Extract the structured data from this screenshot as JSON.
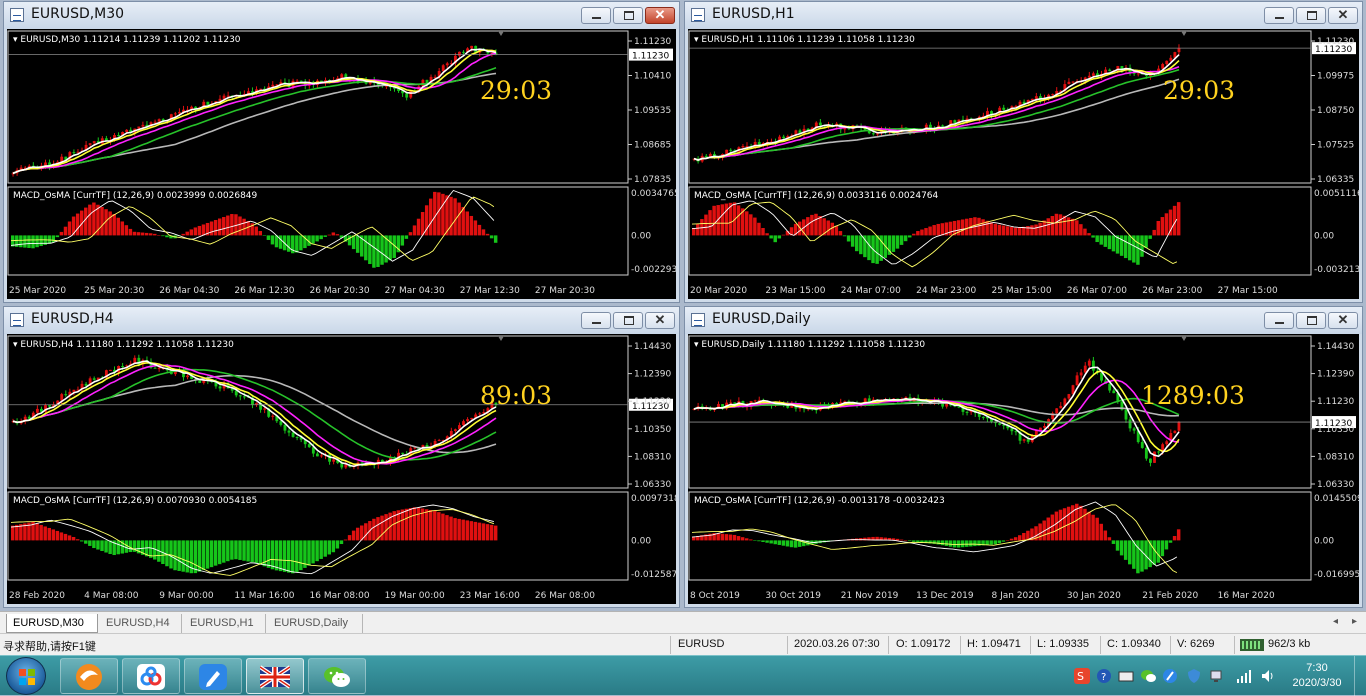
{
  "colors": {
    "bull": "#e01010",
    "bear": "#16c51a",
    "ema_fast": "#ffffff",
    "ema_mid": "#ffff33",
    "ema_slow": "#ff22ff",
    "sma_green": "#27c22a",
    "sma_gray": "#b8b8b8",
    "timer": "#ffd21f"
  },
  "windows": [
    {
      "id": "m30",
      "title": "EURUSD,M30",
      "close_active": true,
      "header": "EURUSD,M30  1.11214 1.11239 1.11202 1.11230",
      "timer": "29:03",
      "price_axis": [
        "1.11230",
        "1.10410",
        "1.09535",
        "1.08685",
        "1.07835"
      ],
      "bid_label": "1.11230",
      "macd_header": "MACD_OsMA [CurrTF] (12,26,9) 0.0023999 0.0026849",
      "macd_axis": [
        "0.0034765",
        "0.00",
        "-0.002293"
      ],
      "time_axis": [
        "25 Mar 2020",
        "25 Mar 20:30",
        "26 Mar 04:30",
        "26 Mar 12:30",
        "26 Mar 20:30",
        "27 Mar 04:30",
        "27 Mar 12:30",
        "27 Mar 20:30"
      ],
      "trend": [
        0.05,
        0.08,
        0.18,
        0.28,
        0.36,
        0.44,
        0.52,
        0.6,
        0.66,
        0.7,
        0.72,
        0.76,
        0.7,
        0.62,
        0.78,
        0.98,
        0.93
      ],
      "macd_hist": [
        -0.3,
        -0.35,
        -0.2,
        0.5,
        0.9,
        0.6,
        0.1,
        0.05,
        -0.1,
        0.2,
        0.4,
        0.6,
        0.3,
        -0.3,
        -0.5,
        -0.2,
        0.1,
        -0.4,
        -0.9,
        -0.6,
        0.3,
        1.2,
        1.0,
        0.4,
        -0.2
      ]
    },
    {
      "id": "h1",
      "title": "EURUSD,H1",
      "close_active": false,
      "header": "EURUSD,H1  1.11106 1.11239 1.11058 1.11230",
      "timer": "29:03",
      "price_axis": [
        "1.11230",
        "1.09975",
        "1.08750",
        "1.07525",
        "1.06335"
      ],
      "bid_label": "1.11230",
      "macd_header": "MACD_OsMA [CurrTF] (12,26,9) 0.0033116 0.0024764",
      "macd_axis": [
        "0.0051116",
        "0.00",
        "-0.003213"
      ],
      "time_axis": [
        "20 Mar 2020",
        "23 Mar 15:00",
        "24 Mar 07:00",
        "24 Mar 23:00",
        "25 Mar 15:00",
        "26 Mar 07:00",
        "26 Mar 23:00",
        "27 Mar 15:00"
      ],
      "trend": [
        0.12,
        0.18,
        0.24,
        0.3,
        0.4,
        0.38,
        0.34,
        0.36,
        0.38,
        0.44,
        0.5,
        0.56,
        0.66,
        0.76,
        0.82,
        0.76,
        0.96
      ],
      "macd_hist": [
        0.2,
        0.8,
        0.9,
        0.5,
        -0.2,
        0.3,
        0.6,
        0.3,
        -0.4,
        -0.8,
        -0.4,
        0.1,
        0.3,
        0.4,
        0.5,
        0.3,
        0.2,
        0.3,
        0.6,
        0.4,
        -0.2,
        -0.5,
        -0.8,
        0.4,
        0.9
      ]
    },
    {
      "id": "h4",
      "title": "EURUSD,H4",
      "close_active": false,
      "header": "EURUSD,H4  1.11180 1.11292 1.11058 1.11230",
      "timer": "89:03",
      "price_axis": [
        "1.14430",
        "1.12390",
        "1.11230",
        "1.10350",
        "1.08310",
        "1.06330"
      ],
      "bid_label": "1.11230",
      "macd_header": "MACD_OsMA [CurrTF] (12,26,9) 0.0070930 0.0054185",
      "macd_axis": [
        "0.0097318",
        "0.00",
        "-0.012587"
      ],
      "time_axis": [
        "28 Feb 2020",
        "4 Mar 08:00",
        "9 Mar 00:00",
        "11 Mar 16:00",
        "16 Mar 08:00",
        "19 Mar 00:00",
        "23 Mar 16:00",
        "26 Mar 08:00"
      ],
      "trend": [
        0.45,
        0.55,
        0.7,
        0.82,
        0.92,
        0.86,
        0.78,
        0.72,
        0.6,
        0.4,
        0.22,
        0.12,
        0.15,
        0.22,
        0.3,
        0.45,
        0.6
      ],
      "macd_hist": [
        0.4,
        0.5,
        0.3,
        0.1,
        -0.2,
        -0.4,
        -0.3,
        -0.5,
        -0.8,
        -0.9,
        -0.7,
        -0.5,
        -0.6,
        -0.8,
        -0.9,
        -0.6,
        -0.3,
        0.3,
        0.6,
        0.8,
        0.9,
        0.8,
        0.6,
        0.5,
        0.4
      ]
    },
    {
      "id": "d1",
      "title": "EURUSD,Daily",
      "close_active": false,
      "header": "EURUSD,Daily  1.11180 1.11292 1.11058 1.11230",
      "timer": "1289:03",
      "price_axis": [
        "1.14430",
        "1.12390",
        "1.11230",
        "1.10350",
        "1.08310",
        "1.06330"
      ],
      "bid_label": "1.11230",
      "macd_header": "MACD_OsMA [CurrTF] (12,26,9) -0.0013178 -0.0032423",
      "macd_axis": [
        "0.0145509",
        "0.00",
        "-0.016995"
      ],
      "time_axis": [
        "8 Oct 2019",
        "30 Oct 2019",
        "21 Nov 2019",
        "13 Dec 2019",
        "8 Jan 2020",
        "30 Jan 2020",
        "21 Feb 2020",
        "16 Mar 2020"
      ],
      "trend": [
        0.55,
        0.58,
        0.6,
        0.58,
        0.56,
        0.6,
        0.62,
        0.64,
        0.6,
        0.55,
        0.45,
        0.3,
        0.55,
        0.92,
        0.6,
        0.15,
        0.45
      ],
      "macd_hist": [
        0.1,
        0.2,
        0.15,
        0.0,
        -0.1,
        -0.2,
        -0.1,
        0.0,
        0.05,
        0.1,
        0.05,
        -0.05,
        -0.1,
        -0.2,
        -0.15,
        -0.1,
        0.1,
        0.4,
        0.8,
        1.0,
        0.6,
        -0.3,
        -0.9,
        -0.6,
        0.3
      ]
    }
  ],
  "tabs": [
    "EURUSD,M30",
    "EURUSD,H4",
    "EURUSD,H1",
    "EURUSD,Daily"
  ],
  "tab_arrows": [
    "◂",
    "▸"
  ],
  "status": {
    "help": "寻求帮助,请按F1键",
    "symbol": "EURUSD",
    "datetime": "2020.03.26 07:30",
    "open": "O: 1.09172",
    "high": "H: 1.09471",
    "low": "L: 1.09335",
    "close": "C: 1.09340",
    "volume": "V: 6269",
    "traffic": "962/3 kb"
  },
  "taskbar": {
    "apps": [
      "fox-app-icon",
      "baidu-cloud-icon",
      "pen-note-icon",
      "metatrader-flag-icon",
      "wechat-icon"
    ],
    "time": "7:30",
    "date": "2020/3/30"
  }
}
